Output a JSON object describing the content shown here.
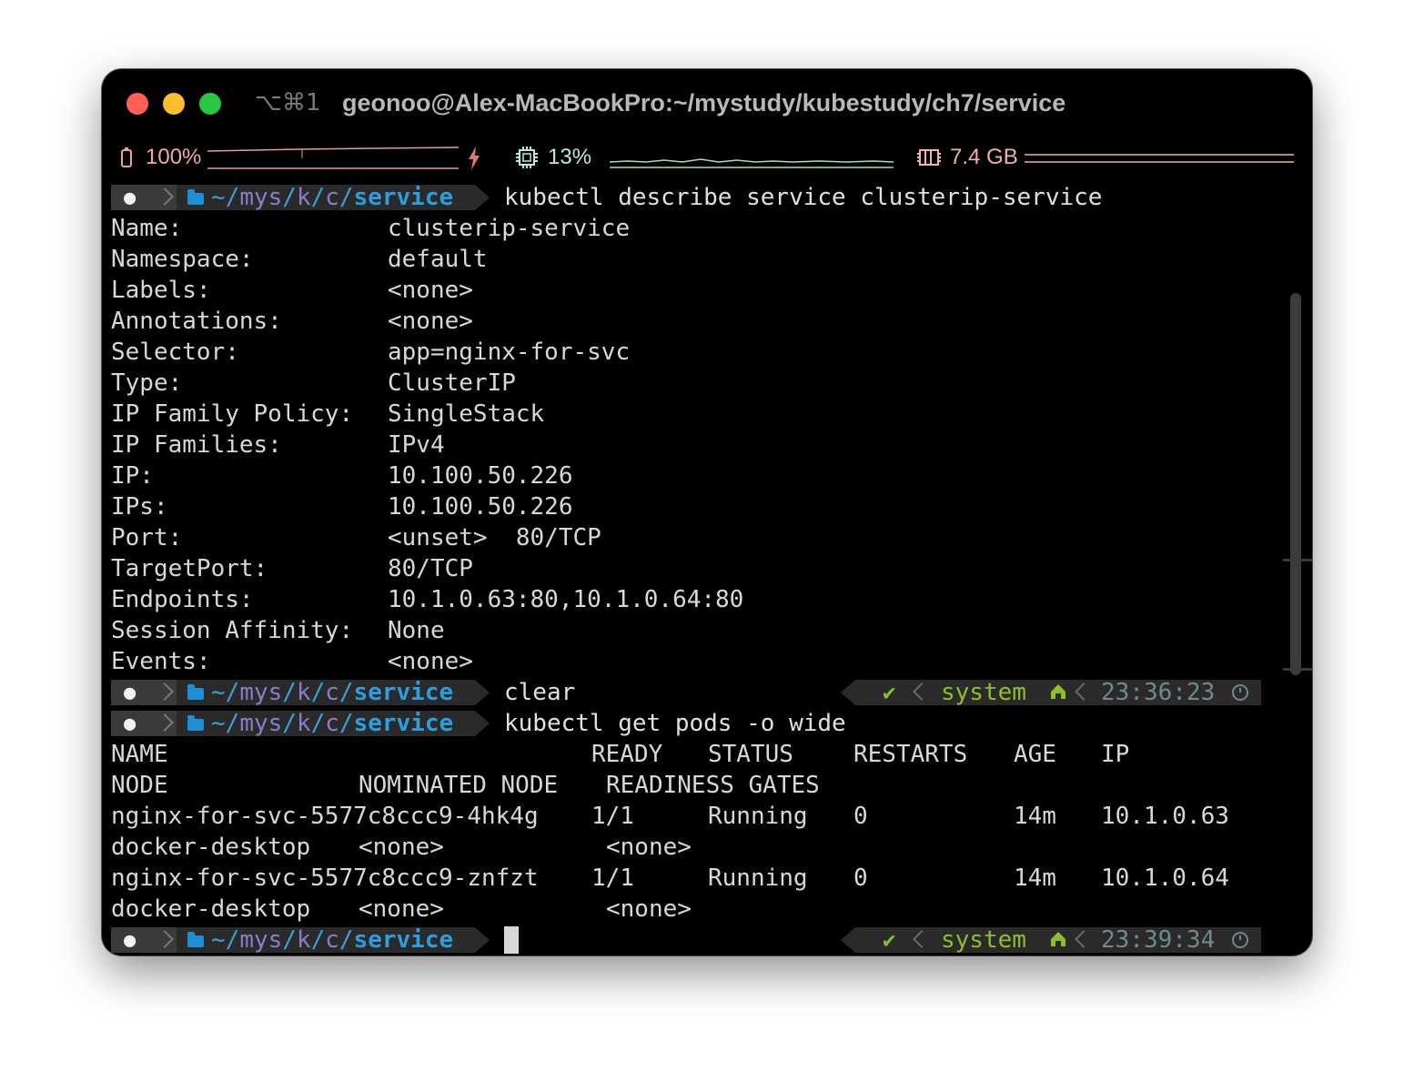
{
  "window": {
    "shortcut": "⌥⌘1",
    "title": "geonoo@Alex-MacBookPro:~/mystudy/kubestudy/ch7/service"
  },
  "statusbar": {
    "battery": "100%",
    "cpu": "13%",
    "memory": "7.4 GB"
  },
  "prompt": {
    "path_segments": [
      "~/",
      "mys",
      "/",
      "k",
      "/",
      "c",
      "/",
      "service"
    ],
    "user": "system"
  },
  "session": {
    "cmd1": "kubectl describe service clusterip-service",
    "describe": [
      {
        "key": "Name:",
        "value": "clusterip-service"
      },
      {
        "key": "Namespace:",
        "value": "default"
      },
      {
        "key": "Labels:",
        "value": "<none>"
      },
      {
        "key": "Annotations:",
        "value": "<none>"
      },
      {
        "key": "Selector:",
        "value": "app=nginx-for-svc"
      },
      {
        "key": "Type:",
        "value": "ClusterIP"
      },
      {
        "key": "IP Family Policy:",
        "value": "SingleStack"
      },
      {
        "key": "IP Families:",
        "value": "IPv4"
      },
      {
        "key": "IP:",
        "value": "10.100.50.226"
      },
      {
        "key": "IPs:",
        "value": "10.100.50.226"
      },
      {
        "key": "Port:",
        "value": "<unset>  80/TCP"
      },
      {
        "key": "TargetPort:",
        "value": "80/TCP"
      },
      {
        "key": "Endpoints:",
        "value": "10.1.0.63:80,10.1.0.64:80"
      },
      {
        "key": "Session Affinity:",
        "value": "None"
      },
      {
        "key": "Events:",
        "value": "<none>"
      }
    ],
    "cmd2": "clear",
    "time2": "23:36:23",
    "cmd3": "kubectl get pods -o wide",
    "headers1": [
      "NAME",
      "READY",
      "STATUS",
      "RESTARTS",
      "AGE",
      "IP"
    ],
    "headers2": [
      "NODE",
      "NOMINATED NODE",
      "READINESS GATES"
    ],
    "pods": [
      {
        "name": "nginx-for-svc-5577c8ccc9-4hk4g",
        "ready": "1/1",
        "status": "Running",
        "restarts": "0",
        "age": "14m",
        "ip": "10.1.0.63",
        "node": "docker-desktop",
        "nominated": "<none>",
        "gates": "<none>"
      },
      {
        "name": "nginx-for-svc-5577c8ccc9-znfzt",
        "ready": "1/1",
        "status": "Running",
        "restarts": "0",
        "age": "14m",
        "ip": "10.1.0.64",
        "node": "docker-desktop",
        "nominated": "<none>",
        "gates": "<none>"
      }
    ],
    "time4": "23:39:34"
  }
}
